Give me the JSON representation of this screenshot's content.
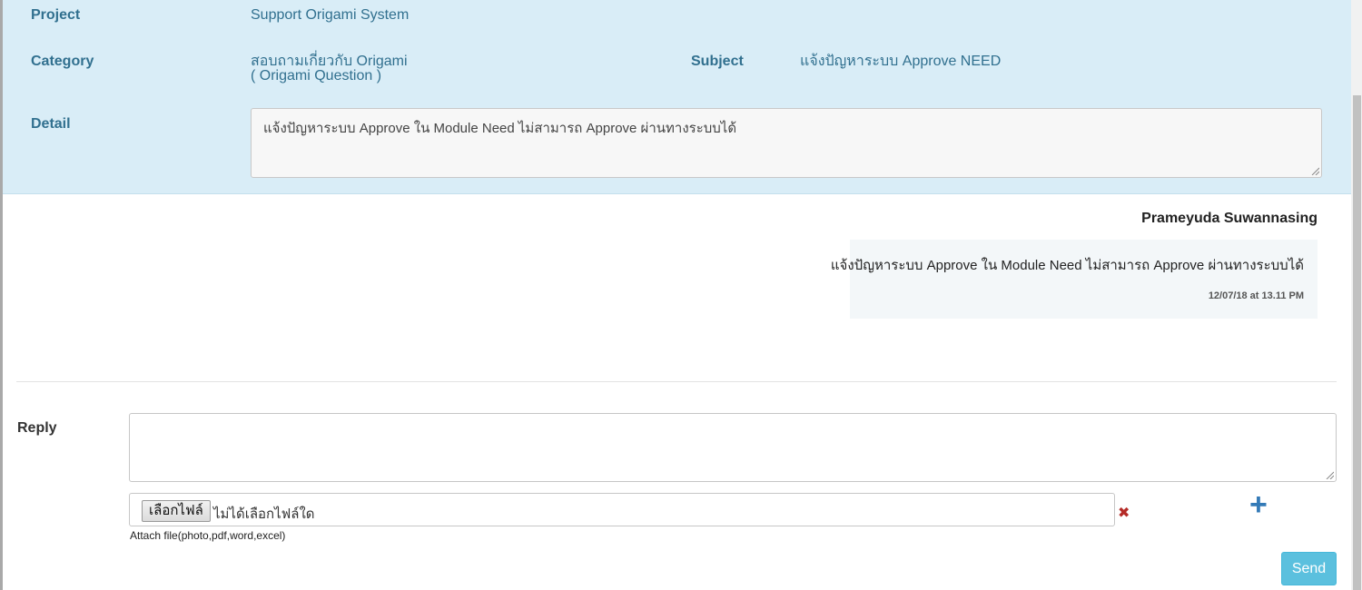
{
  "ticket": {
    "project_label": "Project",
    "project_value": "Support Origami System",
    "category_label": "Category",
    "category_value_line1": "สอบถามเกี่ยวกับ Origami",
    "category_value_line2": "( Origami Question )",
    "subject_label": "Subject",
    "subject_value": "แจ้งปัญหาระบบ Approve NEED",
    "detail_label": "Detail",
    "detail_value": "แจ้งปัญหาระบบ Approve ใน Module Need ไม่สามารถ Approve ผ่านทางระบบได้"
  },
  "message": {
    "author": "Prameyuda Suwannasing",
    "text": "แจ้งปัญหาระบบ Approve ใน Module Need ไม่สามารถ Approve ผ่านทางระบบได้",
    "timestamp": "12/07/18 at 13.11 PM"
  },
  "reply": {
    "label": "Reply",
    "text_value": "",
    "file_button_label": "เลือกไฟล์",
    "file_status": "ไม่ได้เลือกไฟล์ใด",
    "attach_hint": "Attach file(photo,pdf,word,excel)",
    "send_label": "Send"
  },
  "icons": {
    "remove_file": "close-icon",
    "add_file": "plus-icon"
  },
  "colors": {
    "panel_bg": "#d9edf7",
    "label_text": "#31708f",
    "send_button": "#5bc0de",
    "add_icon": "#337ab7",
    "remove_icon": "#b52b27"
  }
}
